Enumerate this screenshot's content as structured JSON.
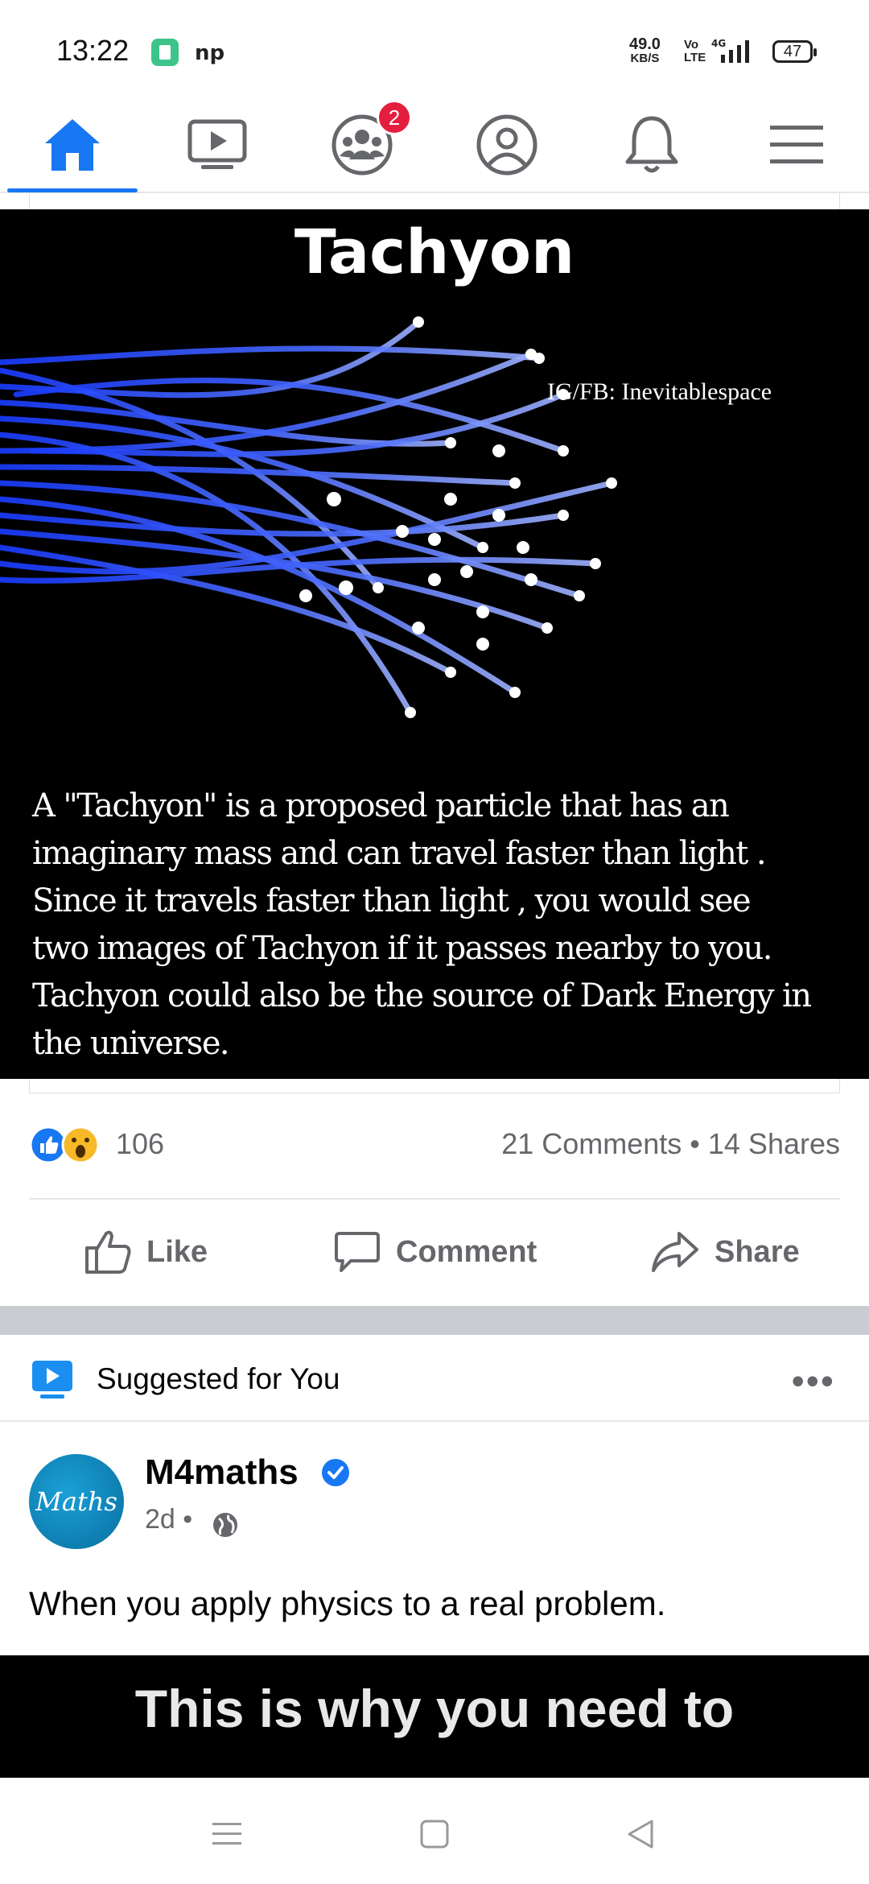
{
  "status_bar": {
    "time": "13:22",
    "speed_value": "49.0",
    "speed_unit": "KB/S",
    "volte": "Vo LTE",
    "network": "4G",
    "battery": "47"
  },
  "top_nav": {
    "items": [
      "home",
      "watch",
      "groups",
      "profile",
      "notifications",
      "menu"
    ],
    "groups_badge": "2",
    "accent": "#1877f2"
  },
  "post": {
    "image": {
      "title": "Tachyon",
      "credit": "IG/FB: Inevitablespace",
      "body_lines": [
        "A \"Tachyon\" is a proposed particle that has an",
        "imaginary mass and can travel faster than light .",
        "Since it travels faster than light , you would see",
        "two images of Tachyon if it passes nearby to you.",
        "Tachyon could also be the source of Dark Energy in",
        "the universe."
      ]
    },
    "reaction_count": "106",
    "stats": "21 Comments • 14 Shares",
    "actions": {
      "like": "Like",
      "comment": "Comment",
      "share": "Share"
    }
  },
  "suggested": {
    "label": "Suggested for You",
    "more": "•••",
    "page_name": "M4maths",
    "avatar_text": "Maths",
    "time": "2d •",
    "caption": "When you apply physics to a real problem.",
    "preview_text": "This is why you need to"
  }
}
